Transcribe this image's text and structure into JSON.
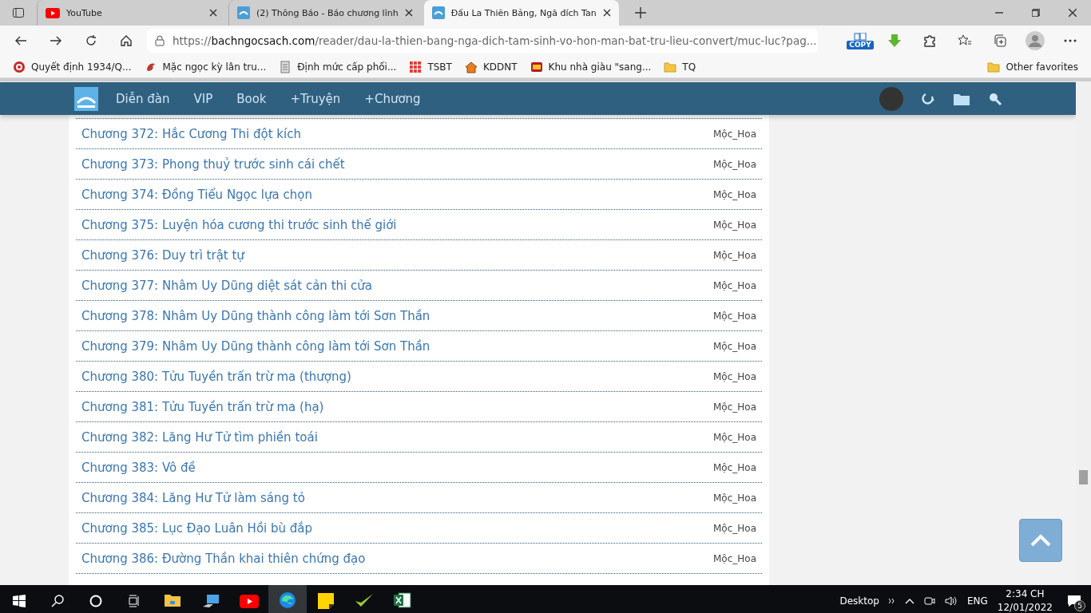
{
  "browser": {
    "tabs": [
      {
        "title": "YouTube",
        "selected": false
      },
      {
        "title": "(2) Thông Báo - Báo chương lĩnh",
        "selected": false
      },
      {
        "title": "Đấu La Thiên Bảng, Ngã đích Tan",
        "selected": true
      }
    ],
    "address": {
      "scheme": "https://",
      "domain": "bachngocsach.com",
      "path": "/reader/dau-la-thien-bang-nga-dich-tam-sinh-vo-hon-man-bat-tru-lieu-convert/muc-luc?pag..."
    },
    "copy_extension": "COPY",
    "bookmarks": [
      "Quyết định 1934/Q...",
      "Mặc ngọc kỳ lân tru...",
      "Định mức cấp phối...",
      "TSBT",
      "KDDNT",
      "Khu nhà giàu \"sang...",
      "TQ"
    ],
    "other_favorites": "Other favorites"
  },
  "site_header": {
    "nav": [
      "Diễn đàn",
      "VIP",
      "Book",
      "+Truyện",
      "+Chương"
    ]
  },
  "chapters": [
    {
      "title": "Chương 372: Hắc Cương Thi đột kích",
      "author": "Mộc_Hoa"
    },
    {
      "title": "Chương 373: Phong thuỷ trước sinh cái chết",
      "author": "Mộc_Hoa"
    },
    {
      "title": "Chương 374: Đồng Tiểu Ngọc lựa chọn",
      "author": "Mộc_Hoa"
    },
    {
      "title": "Chương 375: Luyện hóa cương thi trước sinh thế giới",
      "author": "Mộc_Hoa"
    },
    {
      "title": "Chương 376: Duy trì trật tự",
      "author": "Mộc_Hoa"
    },
    {
      "title": "Chương 377: Nhâm Uy Dũng diệt sát cản thi cửa",
      "author": "Mộc_Hoa"
    },
    {
      "title": "Chương 378: Nhâm Uy Dũng thành công làm tới Sơn Thần",
      "author": "Mộc_Hoa"
    },
    {
      "title": "Chương 379: Nhâm Uy Dũng thành công làm tới Sơn Thần",
      "author": "Mộc_Hoa"
    },
    {
      "title": "Chương 380: Tửu Tuyền trấn trừ ma (thượng)",
      "author": "Mộc_Hoa"
    },
    {
      "title": "Chương 381: Tửu Tuyền trấn trừ ma (hạ)",
      "author": "Mộc_Hoa"
    },
    {
      "title": "Chương 382: Lăng Hư Tử tìm phiền toái",
      "author": "Mộc_Hoa"
    },
    {
      "title": "Chương 383: Vô đề",
      "author": "Mộc_Hoa"
    },
    {
      "title": "Chương 384: Lăng Hư Tử làm sáng tỏ",
      "author": "Mộc_Hoa"
    },
    {
      "title": "Chương 385: Lục Đạo Luân Hồi bù đắp",
      "author": "Mộc_Hoa"
    },
    {
      "title": "Chương 386: Đường Thần khai thiên chứng đạo",
      "author": "Mộc_Hoa"
    }
  ],
  "taskbar": {
    "desktop": "Desktop",
    "language": "ENG",
    "time": "2:34 CH",
    "date": "12/01/2022",
    "notifications": "5"
  }
}
